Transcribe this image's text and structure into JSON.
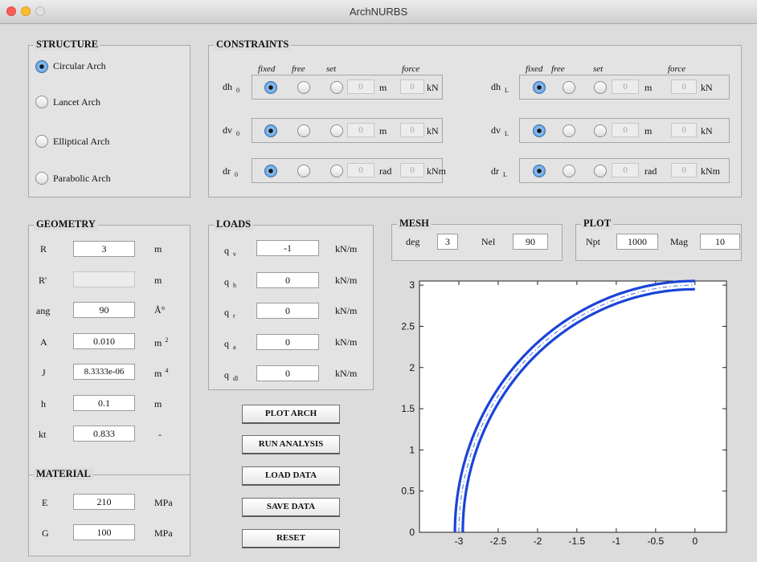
{
  "window": {
    "title": "ArchNURBS"
  },
  "structure": {
    "title": "STRUCTURE",
    "options": [
      "Circular Arch",
      "Lancet Arch",
      "Elliptical Arch",
      "Parabolic Arch"
    ],
    "selected": "Circular Arch"
  },
  "constraints": {
    "title": "CONSTRAINTS",
    "headers": {
      "fixed": "fixed",
      "free": "free",
      "set": "set",
      "force": "force"
    },
    "rows": [
      {
        "label": "dh",
        "sub": "0",
        "selected": "fixed",
        "value": "0",
        "unit": "m",
        "force": "0",
        "force_unit": "kN"
      },
      {
        "label": "dv",
        "sub": "0",
        "selected": "fixed",
        "value": "0",
        "unit": "m",
        "force": "0",
        "force_unit": "kN"
      },
      {
        "label": "dr",
        "sub": "0",
        "selected": "fixed",
        "value": "0",
        "unit": "rad",
        "force": "0",
        "force_unit": "kNm"
      },
      {
        "label": "dh",
        "sub": "L",
        "selected": "fixed",
        "value": "0",
        "unit": "m",
        "force": "0",
        "force_unit": "kN"
      },
      {
        "label": "dv",
        "sub": "L",
        "selected": "fixed",
        "value": "0",
        "unit": "m",
        "force": "0",
        "force_unit": "kN"
      },
      {
        "label": "dr",
        "sub": "L",
        "selected": "fixed",
        "value": "0",
        "unit": "rad",
        "force": "0",
        "force_unit": "kNm"
      }
    ]
  },
  "geometry": {
    "title": "GEOMETRY",
    "rows": [
      {
        "label": "R",
        "value": "3",
        "unit": "m",
        "sup": ""
      },
      {
        "label": "R'",
        "value": "",
        "unit": "m",
        "sup": ""
      },
      {
        "label": "ang",
        "value": "90",
        "unit": "Å°",
        "sup": ""
      },
      {
        "label": "A",
        "value": "0.010",
        "unit": "m",
        "sup": "2"
      },
      {
        "label": "J",
        "value": "8.3333e-06",
        "unit": "m",
        "sup": "4"
      },
      {
        "label": "h",
        "value": "0.1",
        "unit": "m",
        "sup": ""
      },
      {
        "label": "kt",
        "value": "0.833",
        "unit": "-",
        "sup": ""
      }
    ]
  },
  "material": {
    "title": "MATERIAL",
    "rows": [
      {
        "label": "E",
        "value": "210",
        "unit": "MPa"
      },
      {
        "label": "G",
        "value": "100",
        "unit": "MPa"
      }
    ]
  },
  "loads": {
    "title": "LOADS",
    "rows": [
      {
        "label": "q",
        "sub": "v",
        "value": "-1",
        "unit": "kN/m"
      },
      {
        "label": "q",
        "sub": "h",
        "value": "0",
        "unit": "kN/m"
      },
      {
        "label": "q",
        "sub": "r",
        "value": "0",
        "unit": "kN/m"
      },
      {
        "label": "q",
        "sub": "a",
        "value": "0",
        "unit": "kN/m"
      },
      {
        "label": "q",
        "sub": "dl",
        "value": "0",
        "unit": "kN/m"
      }
    ]
  },
  "mesh": {
    "title": "MESH",
    "deg_label": "deg",
    "deg": "3",
    "nel_label": "Nel",
    "nel": "90"
  },
  "plot": {
    "title": "PLOT",
    "npt_label": "Npt",
    "npt": "1000",
    "mag_label": "Mag",
    "mag": "10"
  },
  "buttons": {
    "plot_arch": "PLOT ARCH",
    "run_analysis": "RUN ANALYSIS",
    "load_data": "LOAD DATA",
    "save_data": "SAVE DATA",
    "reset": "RESET"
  },
  "chart_data": {
    "type": "line",
    "title": "",
    "xlabel": "",
    "ylabel": "",
    "xlim": [
      -3.5,
      0.4
    ],
    "ylim": [
      0,
      3.05
    ],
    "xticks": [
      "-3",
      "-2.5",
      "-2",
      "-1.5",
      "-1",
      "-0.5",
      "0"
    ],
    "yticks": [
      "0",
      "0.5",
      "1",
      "1.5",
      "2",
      "2.5",
      "3"
    ],
    "grid": false,
    "series": [
      {
        "radius": 3.05,
        "style": "solid",
        "color": "#1a44d8"
      },
      {
        "radius": 2.95,
        "style": "solid",
        "color": "#1a44d8"
      },
      {
        "radius": 3.0,
        "style": "dashdot",
        "color": "#4a6fd8"
      }
    ]
  }
}
